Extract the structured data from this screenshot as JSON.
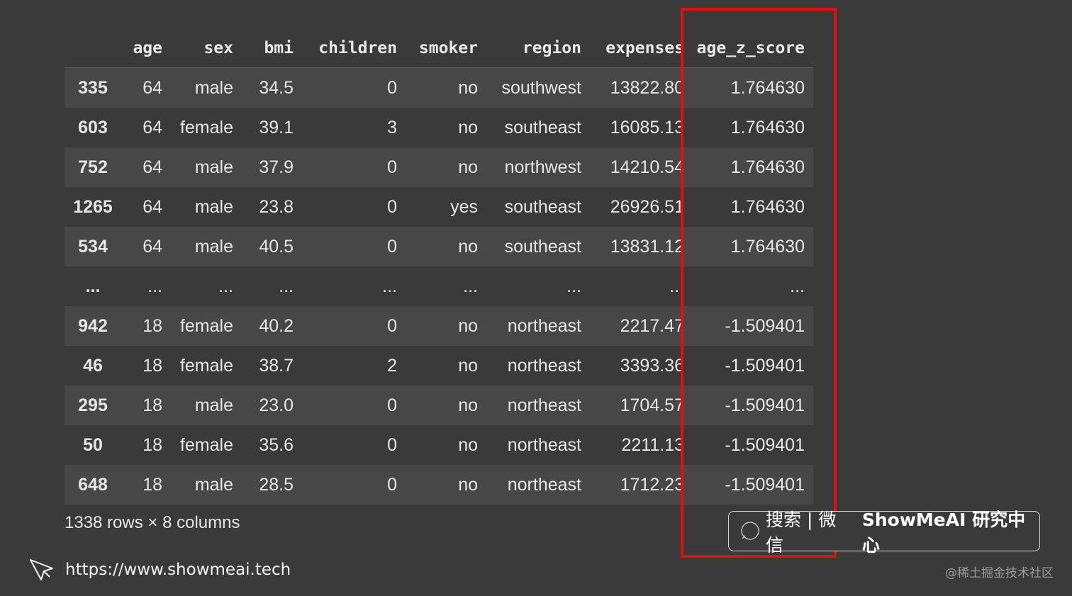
{
  "table": {
    "columns": [
      "",
      "age",
      "sex",
      "bmi",
      "children",
      "smoker",
      "region",
      "expenses",
      "age_z_score"
    ],
    "rows": [
      [
        "335",
        "64",
        "male",
        "34.5",
        "0",
        "no",
        "southwest",
        "13822.80",
        "1.764630"
      ],
      [
        "603",
        "64",
        "female",
        "39.1",
        "3",
        "no",
        "southeast",
        "16085.13",
        "1.764630"
      ],
      [
        "752",
        "64",
        "male",
        "37.9",
        "0",
        "no",
        "northwest",
        "14210.54",
        "1.764630"
      ],
      [
        "1265",
        "64",
        "male",
        "23.8",
        "0",
        "yes",
        "southeast",
        "26926.51",
        "1.764630"
      ],
      [
        "534",
        "64",
        "male",
        "40.5",
        "0",
        "no",
        "southeast",
        "13831.12",
        "1.764630"
      ],
      [
        "...",
        "...",
        "...",
        "...",
        "...",
        "...",
        "...",
        "...",
        "..."
      ],
      [
        "942",
        "18",
        "female",
        "40.2",
        "0",
        "no",
        "northeast",
        "2217.47",
        "-1.509401"
      ],
      [
        "46",
        "18",
        "female",
        "38.7",
        "2",
        "no",
        "northeast",
        "3393.36",
        "-1.509401"
      ],
      [
        "295",
        "18",
        "male",
        "23.0",
        "0",
        "no",
        "northeast",
        "1704.57",
        "-1.509401"
      ],
      [
        "50",
        "18",
        "female",
        "35.6",
        "0",
        "no",
        "northeast",
        "2211.13",
        "-1.509401"
      ],
      [
        "648",
        "18",
        "male",
        "28.5",
        "0",
        "no",
        "northeast",
        "1712.23",
        "-1.509401"
      ]
    ],
    "shape_info": "1338 rows × 8 columns"
  },
  "search_box": {
    "label": "搜索 | 微信",
    "brand": "ShowMeAI 研究中心",
    "icon": "search-icon"
  },
  "footer": {
    "url": "https://www.showmeai.tech",
    "icon": "cursor-icon"
  },
  "watermark": "@稀土掘金技术社区",
  "colors": {
    "background": "#3a3a3a",
    "row_alt": "#474747",
    "highlight": "#e01010",
    "text": "#e6e6e6"
  }
}
